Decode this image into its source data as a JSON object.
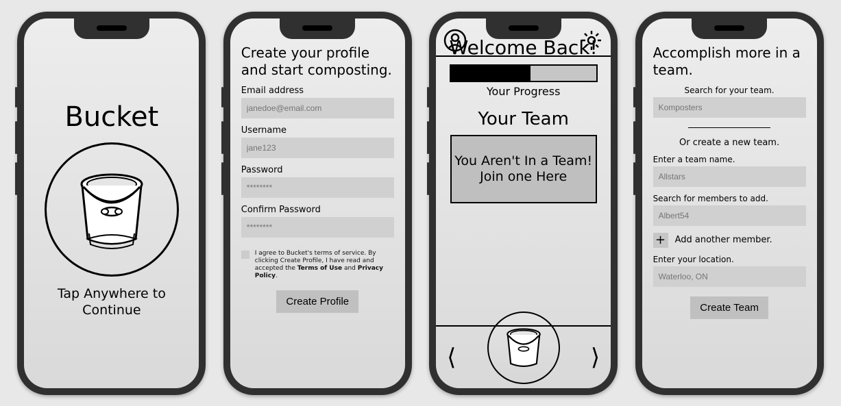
{
  "screen1": {
    "title": "Bucket",
    "tap": "Tap Anywhere to\nContinue"
  },
  "screen2": {
    "heading": "Create your profile and start composting.",
    "email_label": "Email address",
    "email_placeholder": "janedoe@email.com",
    "username_label": "Username",
    "username_placeholder": "jane123",
    "password_label": "Password",
    "password_placeholder": "********",
    "confirm_label": "Confirm Password",
    "confirm_placeholder": "********",
    "terms_pre": "I agree to Bucket's terms of service. By clicking Create Profile, I have read and accepted the ",
    "terms_bold1": "Terms of Use",
    "terms_mid": " and ",
    "terms_bold2": "Privacy Policy",
    "terms_end": ".",
    "button": "Create Profile"
  },
  "screen3": {
    "welcome": "Welcome Back!",
    "progress_label": "Your Progress",
    "progress_percent": 55,
    "your_team": "Your Team",
    "no_team": "You Aren't In a Team!\nJoin one Here"
  },
  "screen4": {
    "heading": "Accomplish more in a team.",
    "search_label": "Search for your team.",
    "search_placeholder": "Komposters",
    "or": "Or create a new team.",
    "name_label": "Enter a team name.",
    "name_placeholder": "Allstars",
    "members_label": "Search for members to add.",
    "members_placeholder": "Albert54",
    "add_member": "Add another member.",
    "location_label": "Enter your location.",
    "location_placeholder": "Waterloo, ON",
    "button": "Create Team"
  }
}
